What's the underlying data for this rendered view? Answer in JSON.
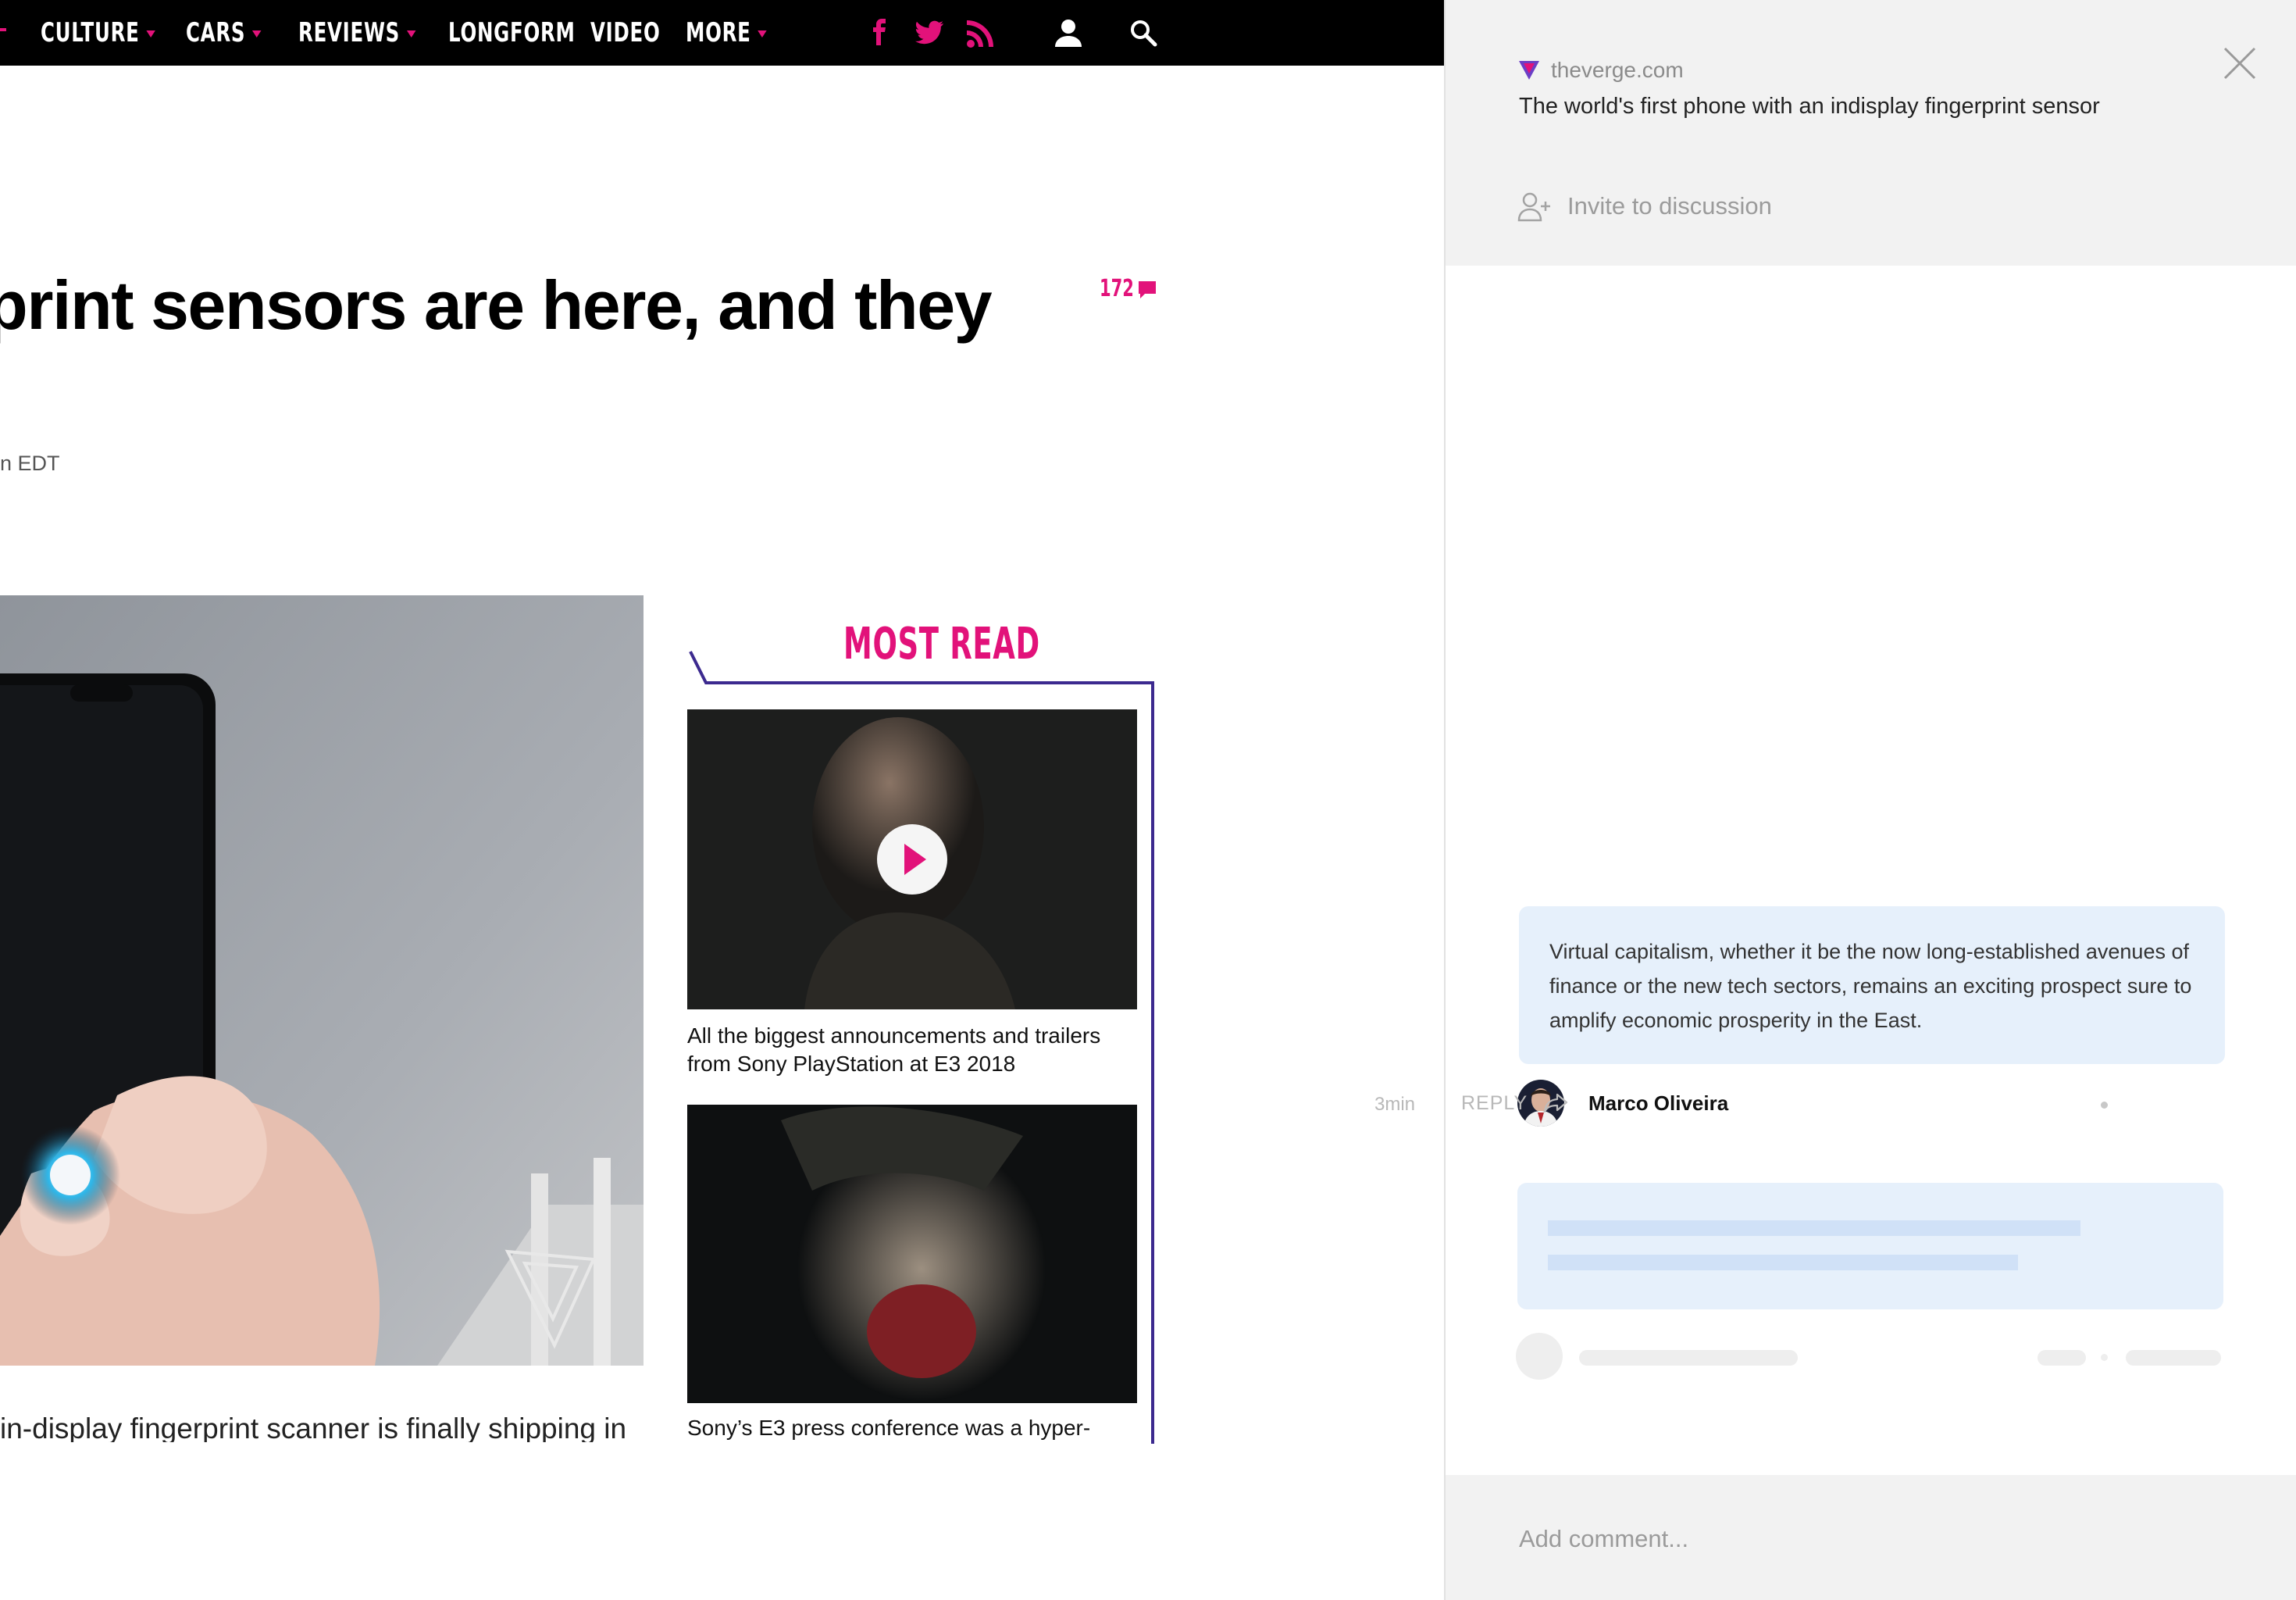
{
  "nav": {
    "items": [
      "CULTURE",
      "CARS",
      "REVIEWS",
      "LONGFORM",
      "VIDEO",
      "MORE"
    ],
    "accent_color": "#e2127a"
  },
  "article": {
    "headline": "print sensors are here, and they",
    "comment_count": "172",
    "byline_time": "n EDT",
    "body_text": "in-display fingerprint scanner is finally shipping in"
  },
  "most_read": {
    "title": "MOST READ",
    "items": [
      {
        "caption": "All the biggest announcements and trailers from Sony PlayStation at E3 2018"
      },
      {
        "caption": "Sony’s E3 press conference was a hyper-"
      }
    ]
  },
  "panel": {
    "site_domain": "theverge.com",
    "page_title": "The world's first phone with an indisplay fingerprint sensor",
    "invite_label": "Invite to discussion",
    "comment": {
      "text": "Virtual capitalism, whether it be the now long-established avenues of finance or the new tech sectors, remains an exciting prospect sure to amplify economic prosperity in the East.",
      "author": "Marco Oliveira",
      "time_ago": "3min",
      "reply_label": "REPLY"
    },
    "composer_placeholder": "Add comment..."
  }
}
